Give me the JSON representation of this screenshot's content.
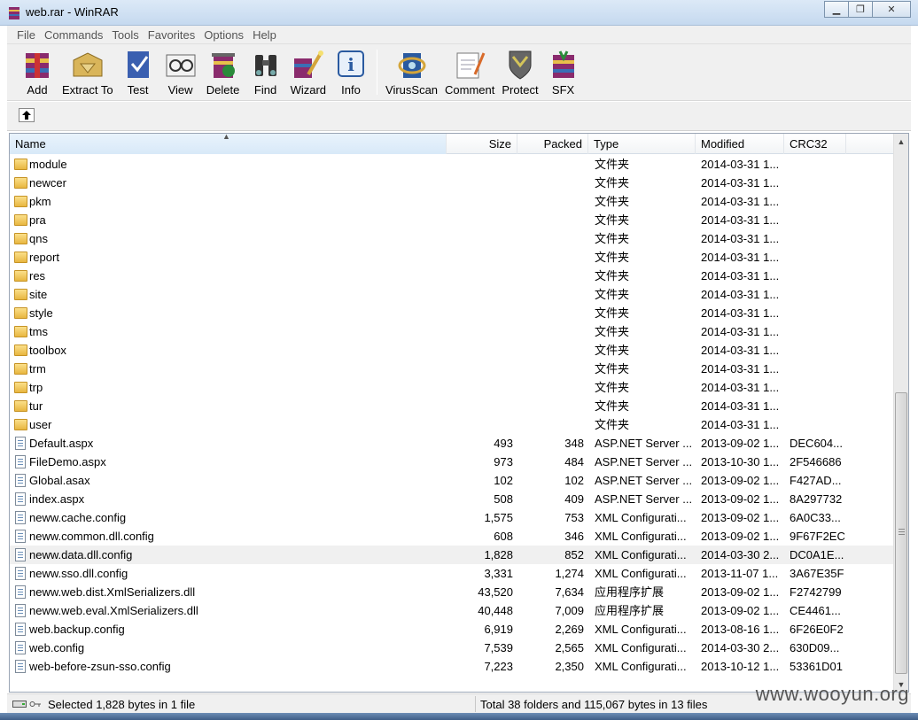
{
  "window": {
    "title": "web.rar - WinRAR"
  },
  "menu": [
    "File",
    "Commands",
    "Tools",
    "Favorites",
    "Options",
    "Help"
  ],
  "toolbar": [
    {
      "label": "Add",
      "icon": "add-archive-icon"
    },
    {
      "label": "Extract To",
      "icon": "extract-icon"
    },
    {
      "label": "Test",
      "icon": "test-icon"
    },
    {
      "label": "View",
      "icon": "view-icon"
    },
    {
      "label": "Delete",
      "icon": "delete-icon"
    },
    {
      "label": "Find",
      "icon": "find-binoculars-icon"
    },
    {
      "label": "Wizard",
      "icon": "wizard-icon"
    },
    {
      "label": "Info",
      "icon": "info-icon"
    },
    {
      "label": "VirusScan",
      "icon": "virusscan-icon"
    },
    {
      "label": "Comment",
      "icon": "comment-icon"
    },
    {
      "label": "Protect",
      "icon": "protect-shield-icon"
    },
    {
      "label": "SFX",
      "icon": "sfx-icon"
    }
  ],
  "columns": {
    "name": "Name",
    "size": "Size",
    "packed": "Packed",
    "type": "Type",
    "modified": "Modified",
    "crc": "CRC32"
  },
  "rows": [
    {
      "kind": "folder",
      "name": "module",
      "size": "",
      "packed": "",
      "type": "文件夹",
      "modified": "2014-03-31 1...",
      "crc": ""
    },
    {
      "kind": "folder",
      "name": "newcer",
      "size": "",
      "packed": "",
      "type": "文件夹",
      "modified": "2014-03-31 1...",
      "crc": ""
    },
    {
      "kind": "folder",
      "name": "pkm",
      "size": "",
      "packed": "",
      "type": "文件夹",
      "modified": "2014-03-31 1...",
      "crc": ""
    },
    {
      "kind": "folder",
      "name": "pra",
      "size": "",
      "packed": "",
      "type": "文件夹",
      "modified": "2014-03-31 1...",
      "crc": ""
    },
    {
      "kind": "folder",
      "name": "qns",
      "size": "",
      "packed": "",
      "type": "文件夹",
      "modified": "2014-03-31 1...",
      "crc": ""
    },
    {
      "kind": "folder",
      "name": "report",
      "size": "",
      "packed": "",
      "type": "文件夹",
      "modified": "2014-03-31 1...",
      "crc": ""
    },
    {
      "kind": "folder",
      "name": "res",
      "size": "",
      "packed": "",
      "type": "文件夹",
      "modified": "2014-03-31 1...",
      "crc": ""
    },
    {
      "kind": "folder",
      "name": "site",
      "size": "",
      "packed": "",
      "type": "文件夹",
      "modified": "2014-03-31 1...",
      "crc": ""
    },
    {
      "kind": "folder",
      "name": "style",
      "size": "",
      "packed": "",
      "type": "文件夹",
      "modified": "2014-03-31 1...",
      "crc": ""
    },
    {
      "kind": "folder",
      "name": "tms",
      "size": "",
      "packed": "",
      "type": "文件夹",
      "modified": "2014-03-31 1...",
      "crc": ""
    },
    {
      "kind": "folder",
      "name": "toolbox",
      "size": "",
      "packed": "",
      "type": "文件夹",
      "modified": "2014-03-31 1...",
      "crc": ""
    },
    {
      "kind": "folder",
      "name": "trm",
      "size": "",
      "packed": "",
      "type": "文件夹",
      "modified": "2014-03-31 1...",
      "crc": ""
    },
    {
      "kind": "folder",
      "name": "trp",
      "size": "",
      "packed": "",
      "type": "文件夹",
      "modified": "2014-03-31 1...",
      "crc": ""
    },
    {
      "kind": "folder",
      "name": "tur",
      "size": "",
      "packed": "",
      "type": "文件夹",
      "modified": "2014-03-31 1...",
      "crc": ""
    },
    {
      "kind": "folder",
      "name": "user",
      "size": "",
      "packed": "",
      "type": "文件夹",
      "modified": "2014-03-31 1...",
      "crc": ""
    },
    {
      "kind": "file",
      "name": "Default.aspx",
      "size": "493",
      "packed": "348",
      "type": "ASP.NET Server ...",
      "modified": "2013-09-02 1...",
      "crc": "DEC604..."
    },
    {
      "kind": "file",
      "name": "FileDemo.aspx",
      "size": "973",
      "packed": "484",
      "type": "ASP.NET Server ...",
      "modified": "2013-10-30 1...",
      "crc": "2F546686"
    },
    {
      "kind": "file",
      "name": "Global.asax",
      "size": "102",
      "packed": "102",
      "type": "ASP.NET Server ...",
      "modified": "2013-09-02 1...",
      "crc": "F427AD..."
    },
    {
      "kind": "file",
      "name": "index.aspx",
      "size": "508",
      "packed": "409",
      "type": "ASP.NET Server ...",
      "modified": "2013-09-02 1...",
      "crc": "8A297732"
    },
    {
      "kind": "file",
      "name": "neww.cache.config",
      "size": "1,575",
      "packed": "753",
      "type": "XML Configurati...",
      "modified": "2013-09-02 1...",
      "crc": "6A0C33..."
    },
    {
      "kind": "file",
      "name": "neww.common.dll.config",
      "size": "608",
      "packed": "346",
      "type": "XML Configurati...",
      "modified": "2013-09-02 1...",
      "crc": "9F67F2EC"
    },
    {
      "kind": "file",
      "name": "neww.data.dll.config",
      "size": "1,828",
      "packed": "852",
      "type": "XML Configurati...",
      "modified": "2014-03-30 2...",
      "crc": "DC0A1E...",
      "selected": true
    },
    {
      "kind": "file",
      "name": "neww.sso.dll.config",
      "size": "3,331",
      "packed": "1,274",
      "type": "XML Configurati...",
      "modified": "2013-11-07 1...",
      "crc": "3A67E35F"
    },
    {
      "kind": "file",
      "name": "neww.web.dist.XmlSerializers.dll",
      "size": "43,520",
      "packed": "7,634",
      "type": "应用程序扩展",
      "modified": "2013-09-02 1...",
      "crc": "F2742799"
    },
    {
      "kind": "file",
      "name": "neww.web.eval.XmlSerializers.dll",
      "size": "40,448",
      "packed": "7,009",
      "type": "应用程序扩展",
      "modified": "2013-09-02 1...",
      "crc": "CE4461..."
    },
    {
      "kind": "file",
      "name": "web.backup.config",
      "size": "6,919",
      "packed": "2,269",
      "type": "XML Configurati...",
      "modified": "2013-08-16 1...",
      "crc": "6F26E0F2"
    },
    {
      "kind": "file",
      "name": "web.config",
      "size": "7,539",
      "packed": "2,565",
      "type": "XML Configurati...",
      "modified": "2014-03-30 2...",
      "crc": "630D09..."
    },
    {
      "kind": "file",
      "name": "web-before-zsun-sso.config",
      "size": "7,223",
      "packed": "2,350",
      "type": "XML Configurati...",
      "modified": "2013-10-12 1...",
      "crc": "53361D01"
    }
  ],
  "status": {
    "left": "Selected 1,828 bytes in 1 file",
    "right": "Total 38 folders and 115,067 bytes in 13 files"
  },
  "watermark": "www.wooyun.org"
}
